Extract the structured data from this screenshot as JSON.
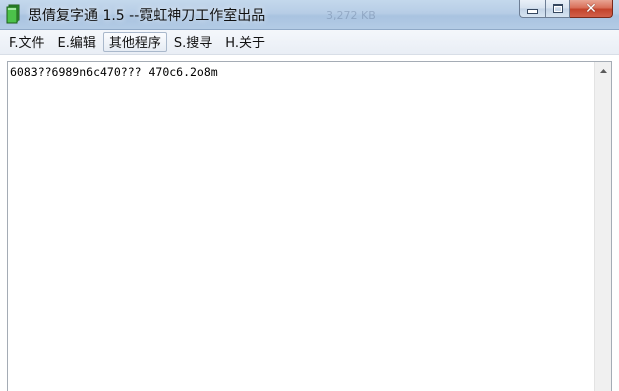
{
  "window": {
    "title": "思倩复字通 1.5 --霓虹神刀工作室出品",
    "ghost_text": "3,272 KB",
    "close_glyph": "✕"
  },
  "menu": {
    "items": [
      {
        "label": "F.文件",
        "highlighted": false
      },
      {
        "label": "E.编辑",
        "highlighted": false
      },
      {
        "label": "其他程序",
        "highlighted": true
      },
      {
        "label": "S.搜寻",
        "highlighted": false
      },
      {
        "label": "H.关于",
        "highlighted": false
      }
    ]
  },
  "editor": {
    "content": "6083??6989n6c470??? 470c6.2o8m"
  },
  "icons": {
    "app": "book-icon",
    "minimize": "minimize-icon",
    "maximize": "maximize-icon",
    "close": "close-icon",
    "scroll_up": "scroll-up-arrow-icon"
  },
  "colors": {
    "titlebar": "#b7cde6",
    "close_button": "#c3432b",
    "app_icon_green": "#3cab3a"
  }
}
